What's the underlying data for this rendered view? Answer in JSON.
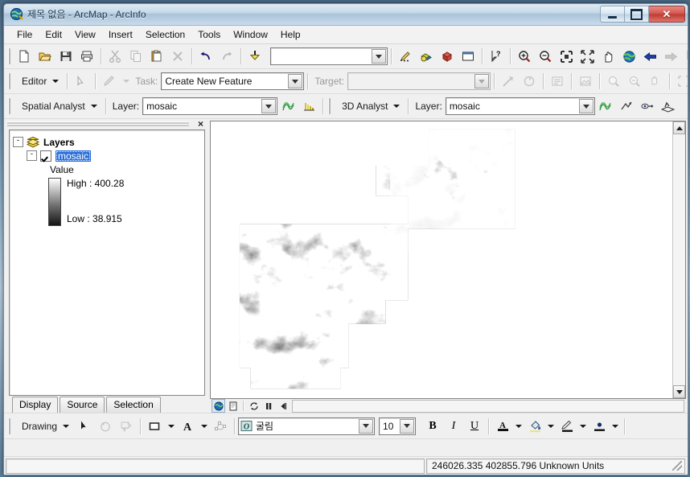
{
  "window": {
    "title": "제목 없음 - ArcMap - ArcInfo",
    "app_icon": "arcmap-globe-icon",
    "minimize_label": "Minimize",
    "maximize_label": "Maximize",
    "close_label": "Close"
  },
  "menubar": {
    "items": [
      {
        "label": "File",
        "accel": "F"
      },
      {
        "label": "Edit",
        "accel": "E"
      },
      {
        "label": "View",
        "accel": "V"
      },
      {
        "label": "Insert",
        "accel": "I"
      },
      {
        "label": "Selection",
        "accel": "S"
      },
      {
        "label": "Tools",
        "accel": "T"
      },
      {
        "label": "Window",
        "accel": "W"
      },
      {
        "label": "Help",
        "accel": "H"
      }
    ]
  },
  "standard_toolbar": {
    "buttons": [
      {
        "name": "new-map-icon",
        "title": "New Map File"
      },
      {
        "name": "open-icon",
        "title": "Open"
      },
      {
        "name": "save-icon",
        "title": "Save"
      },
      {
        "name": "print-icon",
        "title": "Print"
      },
      {
        "name": "cut-icon",
        "title": "Cut"
      },
      {
        "name": "copy-icon",
        "title": "Copy"
      },
      {
        "name": "paste-icon",
        "title": "Paste"
      },
      {
        "name": "delete-icon",
        "title": "Delete"
      },
      {
        "name": "undo-icon",
        "title": "Undo"
      },
      {
        "name": "redo-icon",
        "title": "Redo"
      },
      {
        "name": "add-data-icon",
        "title": "Add Data"
      }
    ],
    "scale_value": "",
    "scale_placeholder": "",
    "right_buttons": [
      {
        "name": "editor-toolbox-icon",
        "title": "Editor Toolbox"
      },
      {
        "name": "arctoolbox-icon",
        "title": "ArcToolbox"
      },
      {
        "name": "model-builder-icon",
        "title": "ModelBuilder"
      },
      {
        "name": "command-line-icon",
        "title": "Show Command Line Window"
      },
      {
        "name": "whats-this-icon",
        "title": "What's This?"
      }
    ],
    "nav_buttons": [
      {
        "name": "zoom-in-icon",
        "title": "Zoom In"
      },
      {
        "name": "zoom-out-icon",
        "title": "Zoom Out"
      },
      {
        "name": "fixed-zoom-in-icon",
        "title": "Fixed Zoom In"
      },
      {
        "name": "fixed-zoom-out-icon",
        "title": "Fixed Zoom Out"
      },
      {
        "name": "pan-icon",
        "title": "Pan"
      },
      {
        "name": "full-extent-icon",
        "title": "Full Extent"
      },
      {
        "name": "back-extent-icon",
        "title": "Go Back To Previous Extent"
      },
      {
        "name": "forward-extent-icon",
        "title": "Go To Next Extent"
      },
      {
        "name": "select-features-icon",
        "title": "Select Features"
      },
      {
        "name": "clear-selection-icon",
        "title": "Clear Selected Features"
      }
    ]
  },
  "editor_toolbar": {
    "menu_label": "Editor",
    "edit_tool_icon": "edit-arrow-icon",
    "sketch_tool_icon": "sketch-pencil-icon",
    "task_label": "Task:",
    "task_value": "Create New Feature",
    "target_label": "Target:",
    "target_value": "",
    "tools": [
      {
        "name": "split-tool-icon",
        "title": "Split Tool"
      },
      {
        "name": "rotate-tool-icon",
        "title": "Rotate Tool"
      },
      {
        "name": "attributes-icon",
        "title": "Attributes"
      },
      {
        "name": "sketch-properties-icon",
        "title": "Sketch Properties"
      },
      {
        "name": "trace-tool-icon",
        "title": "Trace Tool"
      },
      {
        "name": "end-point-arc-icon",
        "title": "End Point Arc Tool"
      },
      {
        "name": "midpoint-tool-icon",
        "title": "Midpoint Tool"
      },
      {
        "name": "intersection-tool-icon",
        "title": "Intersection Tool"
      }
    ]
  },
  "spatial_analyst_toolbar": {
    "menu_label": "Spatial Analyst",
    "layer_label": "Layer:",
    "layer_value": "mosaic",
    "tools": [
      {
        "name": "histogram-green-icon",
        "title": "Create Contour"
      },
      {
        "name": "histogram-yellow-icon",
        "title": "Histogram"
      }
    ]
  },
  "analyst3d_toolbar": {
    "menu_label": "3D Analyst",
    "layer_label": "Layer:",
    "layer_value": "mosaic",
    "tools": [
      {
        "name": "contour-icon",
        "title": "Create Contour"
      },
      {
        "name": "steepest-path-icon",
        "title": "Steepest Path"
      },
      {
        "name": "line-of-sight-icon",
        "title": "Line Of Sight"
      },
      {
        "name": "profile-graph-icon",
        "title": "Create Profile Graph"
      }
    ]
  },
  "toc": {
    "close_label": "×",
    "root": {
      "label": "Layers",
      "icon": "layers-stack-icon",
      "expander": "-"
    },
    "layer": {
      "name": "mosaic",
      "expander": "-",
      "checked": true,
      "value_header": "Value",
      "high_label": "High : 400.28",
      "low_label": "Low : 38.915",
      "ramp_high_color": "#ffffff",
      "ramp_low_color": "#000000"
    },
    "tabs": [
      {
        "label": "Display",
        "active": true
      },
      {
        "label": "Source",
        "active": false
      },
      {
        "label": "Selection",
        "active": false
      }
    ]
  },
  "map_view": {
    "background_color": "#ffffff",
    "raster_name": "mosaic",
    "bottom_buttons": [
      {
        "name": "data-view-icon",
        "title": "Data View",
        "active": true
      },
      {
        "name": "layout-view-icon",
        "title": "Layout View",
        "active": false
      },
      {
        "name": "refresh-view-icon",
        "title": "Refresh View",
        "active": false
      },
      {
        "name": "pause-drawing-icon",
        "title": "Pause Drawing",
        "active": false
      },
      {
        "name": "scroll-left-icon",
        "title": "Scroll Left",
        "active": false
      }
    ]
  },
  "drawing_toolbar": {
    "menu_label": "Drawing",
    "tools": [
      {
        "name": "select-elements-icon",
        "title": "Select Elements"
      },
      {
        "name": "rotate-element-icon",
        "title": "Rotate"
      },
      {
        "name": "html-popup-icon",
        "title": "Identify"
      }
    ],
    "shape_icon": "rectangle-shape-icon",
    "text_icon": "new-text-icon",
    "edit-vertices-icon": "edit-vertices-icon",
    "font_icon": "font-otf-icon",
    "font_value": "굴림",
    "font_size_value": "10",
    "bold_label": "B",
    "italic_label": "I",
    "underline_label": "U",
    "color_buttons": [
      {
        "name": "font-color-icon",
        "title": "Font Color"
      },
      {
        "name": "fill-color-icon",
        "title": "Fill Color"
      },
      {
        "name": "line-color-icon",
        "title": "Line Color"
      },
      {
        "name": "marker-color-icon",
        "title": "Marker Color"
      }
    ]
  },
  "status_bar": {
    "coordinates": "246026.335  402855.796 Unknown Units",
    "left_message": ""
  }
}
